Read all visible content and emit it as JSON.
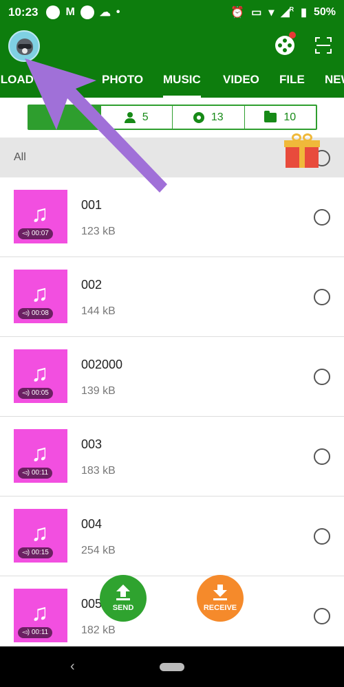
{
  "status_bar": {
    "time": "10:23",
    "carrier_glyph": "M",
    "roaming_indicator": "R",
    "battery": "50%",
    "icons": [
      "alarm-icon",
      "cast-icon",
      "wifi-icon",
      "signal-icon",
      "battery-icon"
    ]
  },
  "header": {
    "avatar": "raccoon-avatar",
    "actions": [
      "film-reel-icon",
      "scan-icon"
    ]
  },
  "tabs": [
    {
      "label": "ILOAD"
    },
    {
      "label": "P"
    },
    {
      "label": "PHOTO"
    },
    {
      "label": "MUSIC",
      "active": true
    },
    {
      "label": "VIDEO"
    },
    {
      "label": "FILE"
    },
    {
      "label": "NEW"
    }
  ],
  "filters": [
    {
      "label": "",
      "icon": "list-icon",
      "selected": true
    },
    {
      "label": "5",
      "icon": "person-icon"
    },
    {
      "label": "13",
      "icon": "disc-icon"
    },
    {
      "label": "10",
      "icon": "folder-icon"
    }
  ],
  "select_all": {
    "label": "All"
  },
  "items": [
    {
      "name": "001",
      "size": "123 kB",
      "duration": "00:07"
    },
    {
      "name": "002",
      "size": "144 kB",
      "duration": "00:08"
    },
    {
      "name": "002000",
      "size": "139 kB",
      "duration": "00:05"
    },
    {
      "name": "003",
      "size": "183 kB",
      "duration": "00:11"
    },
    {
      "name": "004",
      "size": "254 kB",
      "duration": "00:15"
    },
    {
      "name": "005",
      "size": "182 kB",
      "duration": "00:11"
    }
  ],
  "fab": {
    "send": "SEND",
    "receive": "RECEIVE"
  },
  "colors": {
    "primary": "#0d7d0d",
    "accent_green": "#2fa32f",
    "receive_orange": "#f58a2b",
    "thumb_pink": "#f24fe0",
    "annotation_arrow": "#a070d8"
  }
}
